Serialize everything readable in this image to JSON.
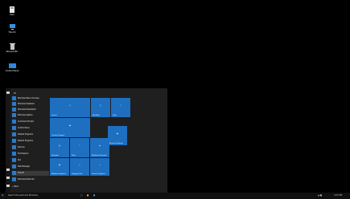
{
  "desktop": {
    "icons": [
      {
        "name": "user-folder",
        "label": "User"
      },
      {
        "name": "this-pc",
        "label": "This PC"
      },
      {
        "name": "recycle-bin",
        "label": "Recycle Bin"
      },
      {
        "name": "control-panel",
        "label": "Control Panel"
      }
    ]
  },
  "start_menu": {
    "letter_w": "W",
    "apps": [
      "Windows Ease of Access",
      "Windows Feedback",
      "Windows PowerShell",
      "Windows System",
      "Command Prompt",
      "Control Panel",
      "Default Programs",
      "Default Programs",
      "Devices",
      "File Explorer",
      "Run",
      "Task Manager",
      "This PC",
      "Windows Defender"
    ],
    "tiles": {
      "search": "Search",
      "word": "WordPad",
      "paint": "Paint",
      "people": "Contact Support",
      "remote": "Remote Desktop",
      "notepad": "Notepad",
      "paint2": "Paint",
      "defender": "Windows Defender",
      "explorer": "Windows Explorer",
      "snip": "Snipping Tool",
      "edge": "Internet Explorer"
    }
  },
  "taskbar": {
    "search_placeholder": "Search the web and Windows",
    "clock": "4:27 PM",
    "back_label": "Back"
  },
  "colors": {
    "tile_blue": "#1e6fc0",
    "menu_bg": "#1f1f1f",
    "taskbar_bg": "#101010"
  }
}
